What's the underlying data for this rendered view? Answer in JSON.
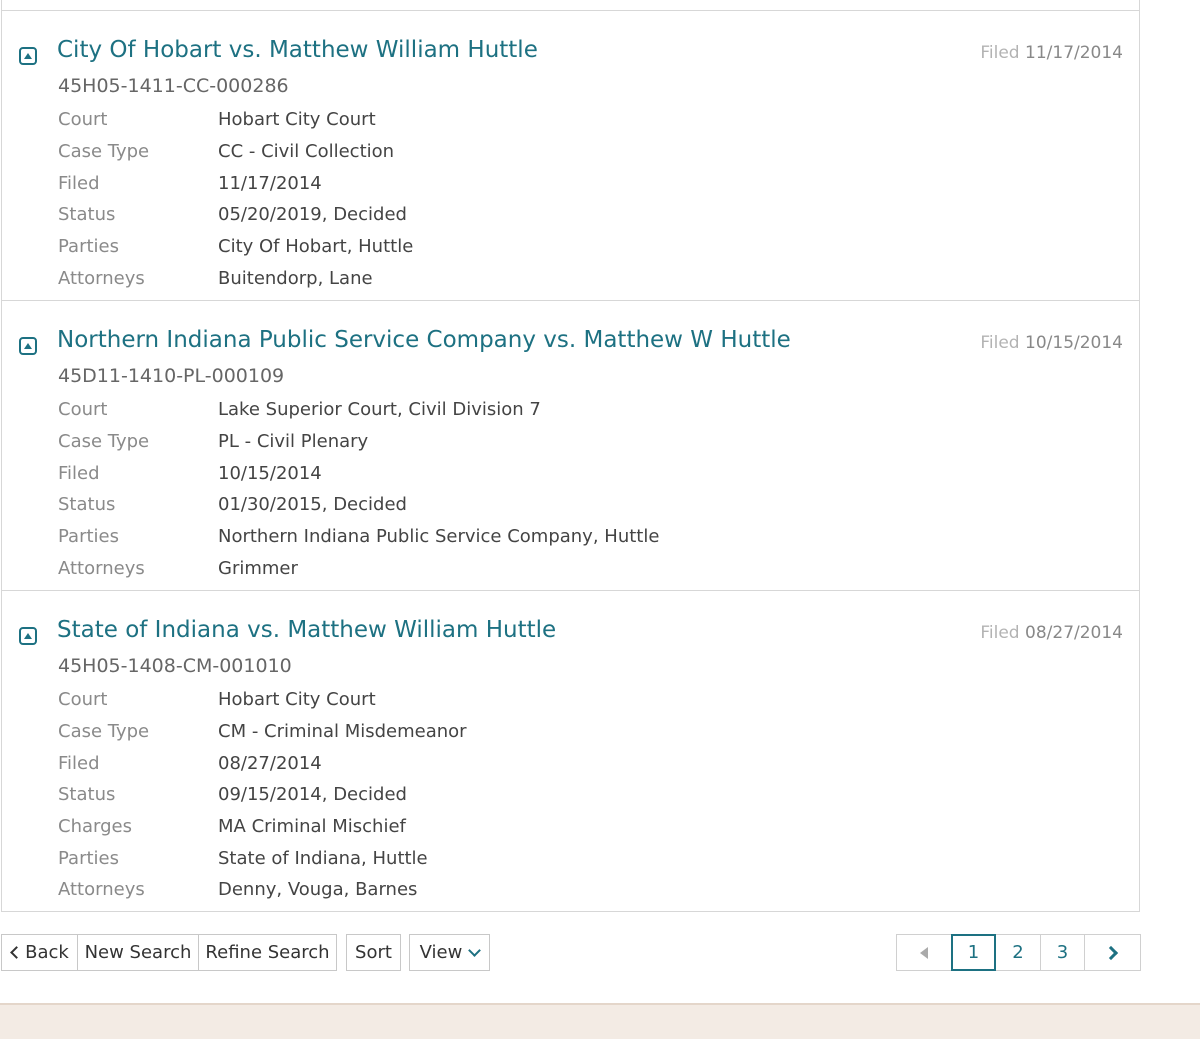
{
  "cases": [
    {
      "title": "City Of Hobart vs. Matthew William Huttle",
      "number": "45H05-1411-CC-000286",
      "filed_label": "Filed",
      "filed_date": "11/17/2014",
      "fields": [
        {
          "key": "Court",
          "value": "Hobart City Court"
        },
        {
          "key": "Case Type",
          "value": "CC - Civil Collection"
        },
        {
          "key": "Filed",
          "value": "11/17/2014"
        },
        {
          "key": "Status",
          "value": "05/20/2019, Decided"
        },
        {
          "key": "Parties",
          "value": "City Of Hobart, Huttle"
        },
        {
          "key": "Attorneys",
          "value": "Buitendorp, Lane"
        }
      ]
    },
    {
      "title": "Northern Indiana Public Service Company vs. Matthew W Huttle",
      "number": "45D11-1410-PL-000109",
      "filed_label": "Filed",
      "filed_date": "10/15/2014",
      "fields": [
        {
          "key": "Court",
          "value": "Lake Superior Court, Civil Division 7"
        },
        {
          "key": "Case Type",
          "value": "PL - Civil Plenary"
        },
        {
          "key": "Filed",
          "value": "10/15/2014"
        },
        {
          "key": "Status",
          "value": "01/30/2015, Decided"
        },
        {
          "key": "Parties",
          "value": "Northern Indiana Public Service Company, Huttle"
        },
        {
          "key": "Attorneys",
          "value": "Grimmer"
        }
      ]
    },
    {
      "title": "State of Indiana vs. Matthew William Huttle",
      "number": "45H05-1408-CM-001010",
      "filed_label": "Filed",
      "filed_date": "08/27/2014",
      "fields": [
        {
          "key": "Court",
          "value": "Hobart City Court"
        },
        {
          "key": "Case Type",
          "value": "CM - Criminal Misdemeanor"
        },
        {
          "key": "Filed",
          "value": "08/27/2014"
        },
        {
          "key": "Status",
          "value": "09/15/2014, Decided"
        },
        {
          "key": "Charges",
          "value": "MA Criminal Mischief"
        },
        {
          "key": "Parties",
          "value": "State of Indiana, Huttle"
        },
        {
          "key": "Attorneys",
          "value": "Denny, Vouga, Barnes"
        }
      ]
    }
  ],
  "toolbar": {
    "back_label": "Back",
    "new_search_label": "New Search",
    "refine_search_label": "Refine Search",
    "sort_label": "Sort",
    "view_label": "View"
  },
  "pagination": {
    "pages": [
      "1",
      "2",
      "3"
    ],
    "current_page": "1"
  },
  "colors": {
    "accent": "#1d7182",
    "footer": "#f3ebe4"
  }
}
